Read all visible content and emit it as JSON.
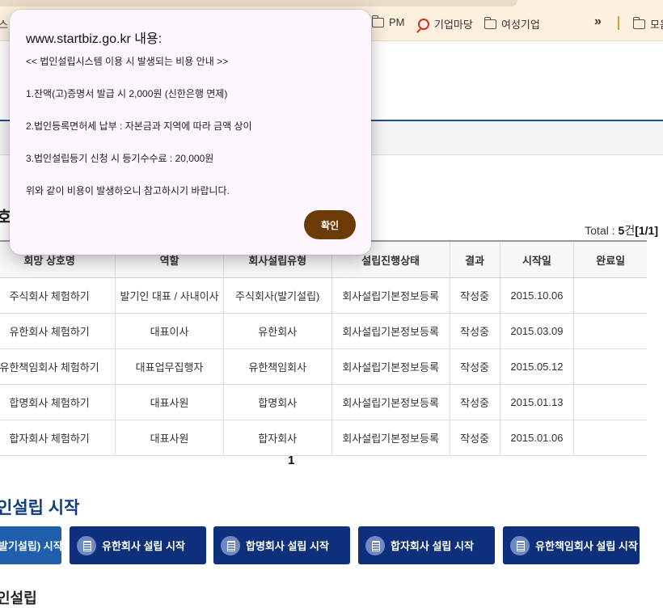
{
  "bookmarks": {
    "items": [
      {
        "label": "PM",
        "icon": "folder-icon"
      },
      {
        "label": "기업마당",
        "icon": "search-icon"
      },
      {
        "label": "여성기업",
        "icon": "folder-icon"
      },
      {
        "label": "모음",
        "icon": "folder-icon"
      }
    ],
    "partial_left": "스",
    "more": "»"
  },
  "page": {
    "partial_heading": "호",
    "total_prefix": "Total : ",
    "total_count": "5",
    "total_unit": "건",
    "total_page": "[1/1]",
    "table_headers": [
      "회망 상호명",
      "역할",
      "회사설립유형",
      "설립진행상태",
      "결과",
      "시작일",
      "완료일"
    ],
    "rows": [
      [
        "주식회사 체험하기",
        "발기인 대표 / 사내이사",
        "주식회사(발기설립)",
        "회사설립기본정보등록",
        "작성중",
        "2015.10.06",
        ""
      ],
      [
        "유한회사 체험하기",
        "대표이사",
        "유한회사",
        "회사설립기본정보등록",
        "작성중",
        "2015.03.09",
        ""
      ],
      [
        "유한책임회사 체험하기",
        "대표업무집행자",
        "유한책임회사",
        "회사설립기본정보등록",
        "작성중",
        "2015.05.12",
        ""
      ],
      [
        "합명회사 체험하기",
        "대표사원",
        "합명회사",
        "회사설립기본정보등록",
        "작성중",
        "2015.01.13",
        ""
      ],
      [
        "합자회사 체험하기",
        "대표사원",
        "합자회사",
        "회사설립기본정보등록",
        "작성중",
        "2015.01.06",
        ""
      ]
    ],
    "pagination": "1",
    "section_title": "인설립 시작",
    "start_buttons": [
      "발기설립) 시작",
      "유한회사 설립 시작",
      "합명회사 설립 시작",
      "합자회사 설립 시작",
      "유한책임회사 설립 시작"
    ],
    "partial_bottom": "인설립"
  },
  "dialog": {
    "title": "www.startbiz.go.kr 내용:",
    "lines": [
      "<< 법인설립시스템 이용 시 발생되는 비용 안내 >>",
      "1.잔액(고)증명서 발급 시 2,000원 (신한은행 면제)",
      "2.법인등록면허세 납부 : 자본금과 지역에 따라 금액 상이",
      "3.법인설립등기 신청 시 등기수수료 : 20,000원",
      "위와 같이 비용이 발생하오니 참고하시기 바랍니다."
    ],
    "ok_label": "확인",
    "ok_color": "#6b3a05"
  }
}
